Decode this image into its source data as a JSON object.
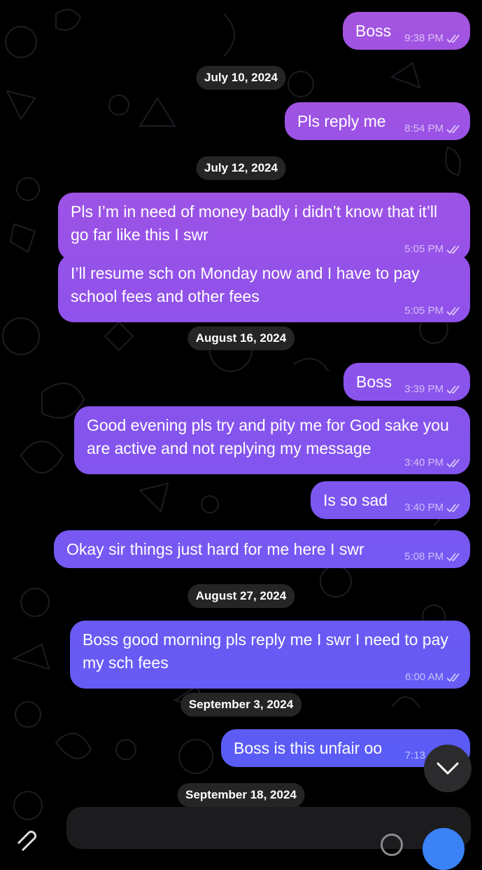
{
  "messages": [
    {
      "id": "m1",
      "text": "Boss",
      "time": "9:38 PM"
    },
    {
      "id": "m2",
      "text": "Pls reply me",
      "time": "8:54 PM"
    },
    {
      "id": "m3",
      "text": "Pls I’m in need of money badly i didn’t know that it’ll go far like this I swr",
      "time": "5:05 PM"
    },
    {
      "id": "m4",
      "text": "I’ll resume sch on Monday now and I have to pay school fees and other fees",
      "time": "5:05 PM"
    },
    {
      "id": "m5",
      "text": "Boss",
      "time": "3:39 PM"
    },
    {
      "id": "m6",
      "text": "Good evening pls try and pity me for God sake you are active and not replying my message",
      "time": "3:40 PM"
    },
    {
      "id": "m7",
      "text": "Is so sad",
      "time": "3:40 PM"
    },
    {
      "id": "m8",
      "text": "Okay sir things just hard for me here I swr",
      "time": "5:08 PM"
    },
    {
      "id": "m9",
      "text": "Boss good morning pls reply me I swr I need to pay my sch fees",
      "time": "6:00 AM"
    },
    {
      "id": "m10",
      "text": "Boss is this unfair oo",
      "time": "7:13"
    }
  ],
  "dates": [
    "July 10, 2024",
    "July 12, 2024",
    "August 16, 2024",
    "August 27, 2024",
    "September 3, 2024",
    "September 18, 2024"
  ],
  "colors": {
    "bubble_top": "#a556e0",
    "bubble_bottom": "#5a5cf0",
    "background": "#000000",
    "date_pill": "#282828"
  },
  "icons": {
    "read_receipt": "double-check-icon",
    "scroll": "chevron-down-icon",
    "attach": "paperclip-icon",
    "emoji": "sticker-icon",
    "send": "send-icon"
  }
}
